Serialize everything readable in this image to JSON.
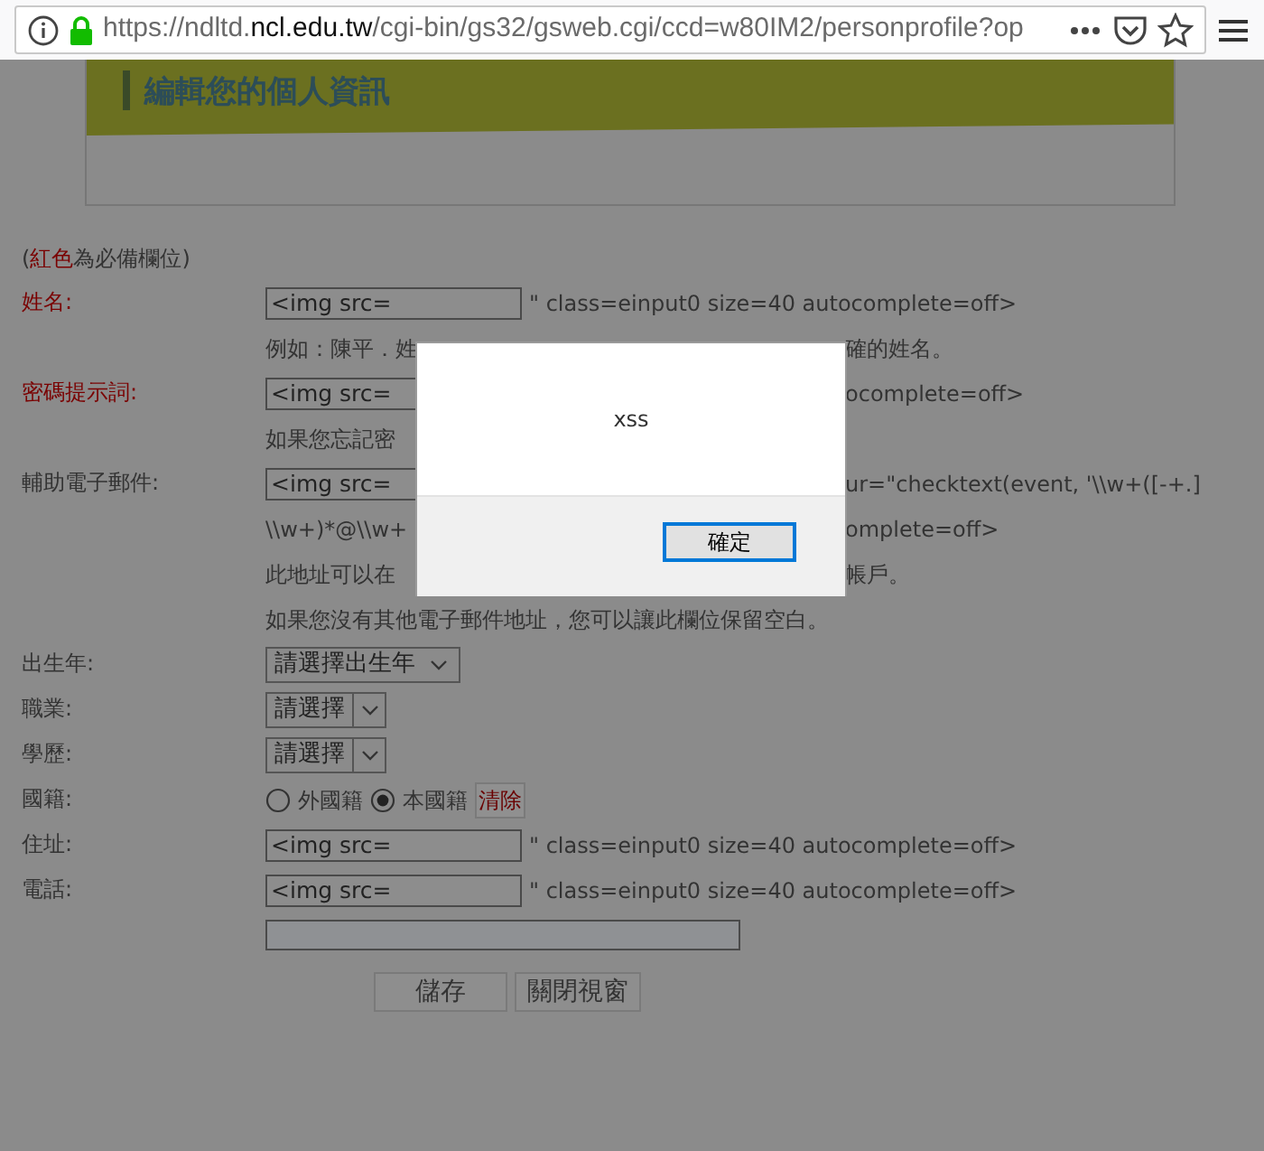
{
  "browser": {
    "url_host_start": "https://ndltd.",
    "url_domain": "ncl.edu.tw",
    "url_path": "/cgi-bin/gs32/gsweb.cgi/ccd=w80IM2/personprofile?op"
  },
  "page_title": "編輯您的個人資訊",
  "required_note": {
    "open": "(",
    "marker": "紅色",
    "rest": " 為必備欄位)"
  },
  "fields": [
    {
      "label": "姓名:",
      "required": true,
      "lines": [
        {
          "pieces": [
            {
              "kind": "input",
              "value": "<img src="
            },
            {
              "kind": "text",
              "text": "\" class=einput0 size=40 autocomplete=off>"
            }
          ]
        },
        {
          "pieces": [
            {
              "kind": "text",
              "text": "例如：陳平．姓"
            }
          ],
          "right": "確的姓名。"
        }
      ]
    },
    {
      "label": "密碼提示詞:",
      "required": true,
      "lines": [
        {
          "pieces": [
            {
              "kind": "input",
              "value": "<img src="
            }
          ],
          "right": "ocomplete=off>"
        },
        {
          "pieces": [
            {
              "kind": "text",
              "text": "如果您忘記密"
            }
          ]
        }
      ]
    },
    {
      "label": "輔助電子郵件:",
      "required": false,
      "lines": [
        {
          "pieces": [
            {
              "kind": "input",
              "value": "<img src="
            }
          ],
          "right": "ur=\"checktext(event, '\\\\w+([-+.]"
        },
        {
          "pieces": [
            {
              "kind": "text",
              "text": "\\\\w+)*@\\\\w+"
            }
          ],
          "right": "omplete=off>"
        },
        {
          "pieces": [
            {
              "kind": "text",
              "text": "此地址可以在"
            }
          ],
          "right": "帳戶。"
        },
        {
          "pieces": [
            {
              "kind": "text",
              "text": "如果您沒有其他電子郵件地址，您可以讓此欄位保留空白。"
            }
          ]
        }
      ]
    },
    {
      "label": "出生年:",
      "required": false,
      "lines": [
        {
          "pieces": [
            {
              "kind": "select",
              "value": "請選擇出生年",
              "boxed_arrow": false
            }
          ]
        }
      ]
    },
    {
      "label": "職業:",
      "required": false,
      "lines": [
        {
          "pieces": [
            {
              "kind": "select",
              "value": "請選擇",
              "boxed_arrow": true
            }
          ]
        }
      ]
    },
    {
      "label": "學歷:",
      "required": false,
      "lines": [
        {
          "pieces": [
            {
              "kind": "select",
              "value": "請選擇",
              "boxed_arrow": true
            }
          ]
        }
      ]
    },
    {
      "label": "國籍:",
      "required": false,
      "lines": [
        {
          "pieces": [
            {
              "kind": "radio",
              "label": "外國籍",
              "selected": false
            },
            {
              "kind": "radio",
              "label": "本國籍",
              "selected": true
            },
            {
              "kind": "link",
              "text": "清除"
            }
          ]
        }
      ]
    },
    {
      "label": "住址:",
      "required": false,
      "lines": [
        {
          "pieces": [
            {
              "kind": "input",
              "value": "<img src="
            },
            {
              "kind": "text",
              "text": "\" class=einput0 size=40 autocomplete=off>"
            }
          ]
        }
      ]
    },
    {
      "label": "電話:",
      "required": false,
      "lines": [
        {
          "pieces": [
            {
              "kind": "input",
              "value": "<img src="
            },
            {
              "kind": "text",
              "text": "\" class=einput0 size=40 autocomplete=off>"
            }
          ]
        }
      ]
    },
    {
      "lines": [
        {
          "pieces": [
            {
              "kind": "wide_input"
            }
          ]
        }
      ]
    }
  ],
  "buttons": [
    "儲存",
    "關閉視窗"
  ],
  "dialog": {
    "message": "xss",
    "button": "確定"
  }
}
